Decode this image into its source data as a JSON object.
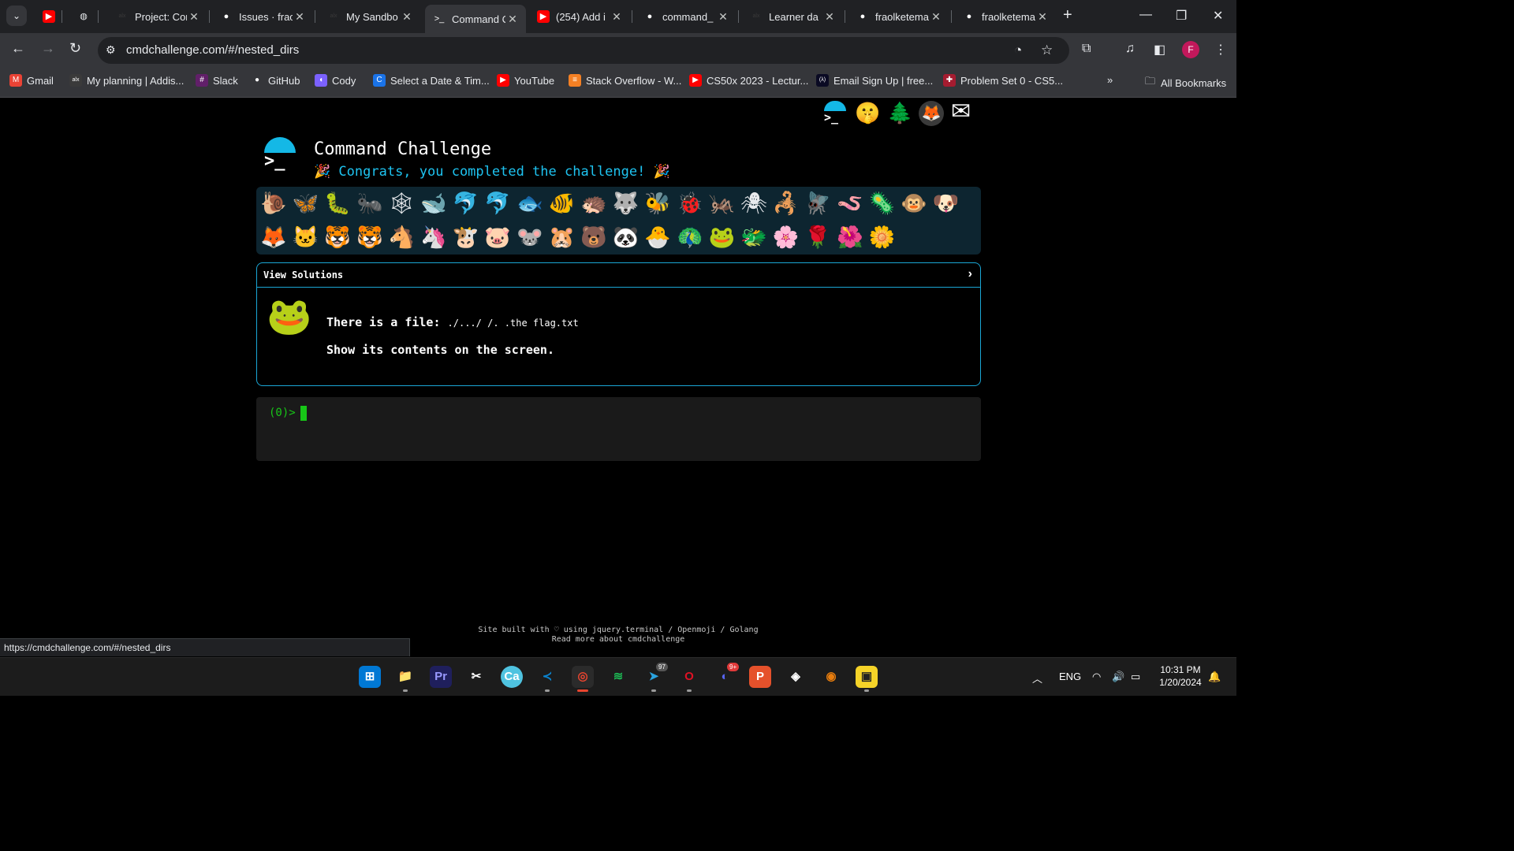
{
  "browser": {
    "tabs": [
      {
        "title": "",
        "favicon": "youtube-icon",
        "favicon_color": "#ff0000"
      },
      {
        "title": "",
        "favicon": "globe-icon",
        "favicon_color": "#e8eaed"
      },
      {
        "title": "Project: Cor",
        "favicon": "alx-icon",
        "favicon_color": "#3a3a3a"
      },
      {
        "title": "Issues · frac",
        "favicon": "github-icon",
        "favicon_color": "#ffffff"
      },
      {
        "title": "My Sandbo",
        "favicon": "alx-icon",
        "favicon_color": "#3a3a3a"
      },
      {
        "title": "Command C",
        "favicon": "terminal-icon",
        "favicon_color": "#ffffff",
        "active": true
      },
      {
        "title": "(254) Add i",
        "favicon": "youtube-icon",
        "favicon_color": "#ff0000"
      },
      {
        "title": "command_",
        "favicon": "github-icon",
        "favicon_color": "#ffffff"
      },
      {
        "title": "Learner da",
        "favicon": "alx-icon",
        "favicon_color": "#3a3a3a"
      },
      {
        "title": "fraolketema",
        "favicon": "github-icon",
        "favicon_color": "#ffffff"
      },
      {
        "title": "fraolketema",
        "favicon": "github-icon",
        "favicon_color": "#ffffff"
      }
    ],
    "url": "cmdchallenge.com/#/nested_dirs",
    "profile_initial": "F",
    "bookmarks": [
      {
        "label": "Gmail",
        "icon": "gmail-icon",
        "color": "#ea4335"
      },
      {
        "label": "My planning | Addis...",
        "icon": "alx-icon",
        "color": "#3a3a3a"
      },
      {
        "label": "Slack",
        "icon": "slack-icon",
        "color": "#611f69"
      },
      {
        "label": "GitHub",
        "icon": "github-icon",
        "color": "#ffffff"
      },
      {
        "label": "Cody",
        "icon": "cody-icon",
        "color": "#7b61ff"
      },
      {
        "label": "Select a Date & Tim...",
        "icon": "calendly-icon",
        "color": "#1a73e8"
      },
      {
        "label": "YouTube",
        "icon": "youtube-icon",
        "color": "#ff0000"
      },
      {
        "label": "Stack Overflow - W...",
        "icon": "stackoverflow-icon",
        "color": "#f48024"
      },
      {
        "label": "CS50x 2023 - Lectur...",
        "icon": "youtube-icon",
        "color": "#ff0000"
      },
      {
        "label": "Email Sign Up | free...",
        "icon": "freecodecamp-icon",
        "color": "#0a0a23"
      },
      {
        "label": "Problem Set 0 - CS5...",
        "icon": "cs50-icon",
        "color": "#a51c30"
      }
    ],
    "all_bookmarks_label": "All Bookmarks",
    "status_url": "https://cmdchallenge.com/#/nested_dirs"
  },
  "site": {
    "title": "Command Challenge",
    "congrats": "Congrats, you completed the challenge!",
    "party_emoji": "🎉",
    "top_icons": [
      "terminal-logo-icon",
      "shushing-face-icon",
      "christmas-tree-icon",
      "gitlab-icon",
      "mail-icon"
    ],
    "top_icon_glyphs": [
      "",
      "🤫",
      "🌲",
      "🦊",
      "✉"
    ],
    "badges_row1": [
      "🐌",
      "🦋",
      "🐛",
      "🐜",
      "🕸",
      "🐋",
      "🐬",
      "🐬",
      "🐟",
      "🐠",
      "🦔",
      "🐺",
      "🐝",
      "🐞",
      "🦗",
      "🕷",
      "🦂",
      "🪰",
      "🪱",
      "🦠",
      "🐵",
      "🐶"
    ],
    "badges_row2": [
      "🦊",
      "🐱",
      "🐯",
      "🐯",
      "🐴",
      "🦄",
      "🐮",
      "🐷",
      "🐭",
      "🐹",
      "🐻",
      "🐼",
      "🐣",
      "🦚",
      "🐸",
      "🐲",
      "🌸",
      "🌹",
      "🌺",
      "🌼"
    ]
  },
  "solutions": {
    "header": "View Solutions",
    "chevron": "›",
    "challenge_icon": "🐸",
    "line1_prefix": "There is a file:",
    "line1_path": "./.../ /. .the flag.txt",
    "line2": "Show its contents on the screen."
  },
  "terminal": {
    "prompt": "(0)>"
  },
  "footer": {
    "line1": "Site built with ♡ using jquery.terminal / Openmoji / Golang",
    "line2": "Read more about cmdchallenge"
  },
  "taskbar": {
    "apps": [
      {
        "name": "start-icon",
        "glyph": "⊞",
        "color": "#0078d4"
      },
      {
        "name": "file-explorer-icon",
        "glyph": "📁",
        "color": "#f3c13a"
      },
      {
        "name": "premiere-pro-icon",
        "glyph": "Pr",
        "color": "#1f1f5c"
      },
      {
        "name": "capcut-icon",
        "glyph": "✂",
        "color": "#ffffff"
      },
      {
        "name": "canva-icon",
        "glyph": "Ca",
        "color": "#4fc3e0"
      },
      {
        "name": "vscode-icon",
        "glyph": "≺",
        "color": "#0a84d0"
      },
      {
        "name": "chrome-icon",
        "glyph": "◎",
        "color": "#e9452f"
      },
      {
        "name": "spotify-icon",
        "glyph": "≋",
        "color": "#1db954"
      },
      {
        "name": "telegram-icon",
        "glyph": "➤",
        "color": "#2aa3df"
      },
      {
        "name": "opera-icon",
        "glyph": "O",
        "color": "#e01124"
      },
      {
        "name": "discord-icon",
        "glyph": "◐",
        "color": "#5865f2"
      },
      {
        "name": "postman-icon",
        "glyph": "P",
        "color": "#e5512b"
      },
      {
        "name": "photos-icon",
        "glyph": "◈",
        "color": "#ffffff"
      },
      {
        "name": "blender-icon",
        "glyph": "◉",
        "color": "#e87d0d"
      },
      {
        "name": "sticky-notes-icon",
        "glyph": "▣",
        "color": "#f5d328"
      }
    ],
    "telegram_badge": "97",
    "discord_badge": "9+",
    "language": "ENG",
    "time": "10:31 PM",
    "date": "1/20/2024"
  }
}
